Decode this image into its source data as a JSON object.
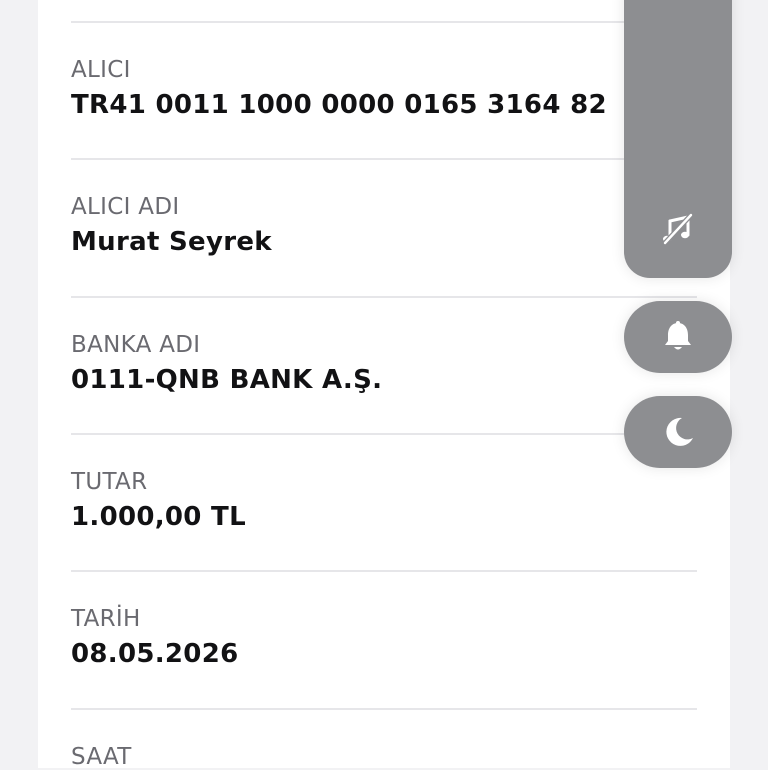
{
  "fields": [
    {
      "label": "",
      "value": ""
    },
    {
      "label": "ALICI",
      "value": "TR41 0011 1000 0000 0165 3164 82"
    },
    {
      "label": "ALICI ADI",
      "value": "Murat Seyrek"
    },
    {
      "label": "BANKA ADI",
      "value": "0111-QNB BANK A.Ş."
    },
    {
      "label": "TUTAR",
      "value": "1.000,00 TL"
    },
    {
      "label": "TARİH",
      "value": "08.05.2026"
    },
    {
      "label": "SAAT",
      "value": ""
    }
  ],
  "controls": {
    "volume_icon": "music-note-off-icon",
    "ring_icon": "bell-icon",
    "focus_icon": "moon-icon",
    "control_color": "#8d8e91"
  }
}
